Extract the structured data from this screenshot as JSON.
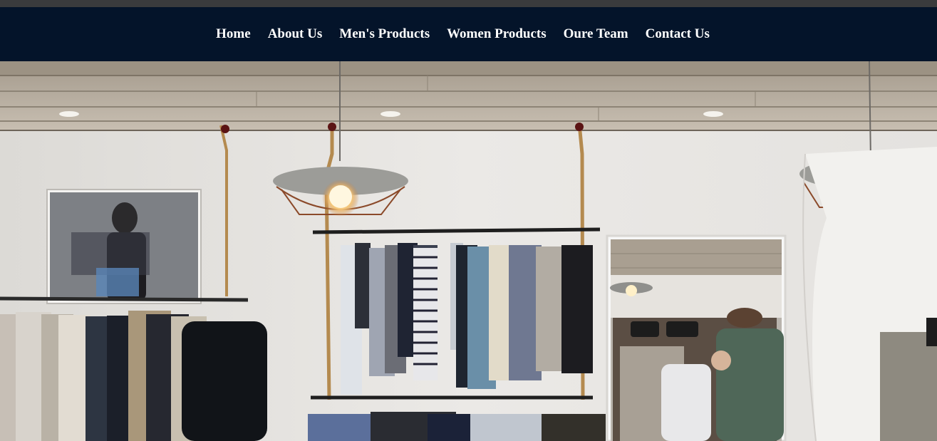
{
  "nav": {
    "items": [
      {
        "label": "Home"
      },
      {
        "label": "About Us"
      },
      {
        "label": "Men's Products"
      },
      {
        "label": "Women Products"
      },
      {
        "label": "Oure Team"
      },
      {
        "label": "Contact Us"
      }
    ]
  },
  "hero": {
    "image": "clothing-store-interior"
  },
  "colors": {
    "navbar_bg": "#04142a",
    "top_strip": "#3a3b3d",
    "nav_text": "#ffffff"
  }
}
